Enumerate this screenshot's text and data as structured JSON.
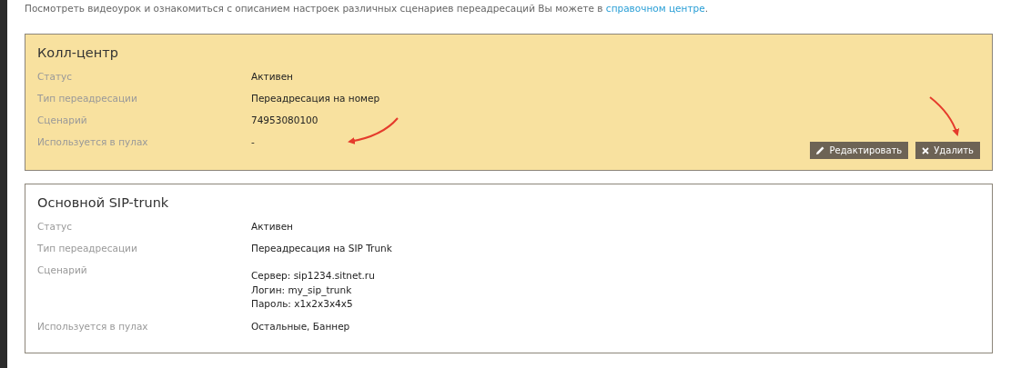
{
  "intro": {
    "text": "Посмотреть видеоурок и ознакомиться с описанием настроек различных сценариев переадресаций Вы можете в ",
    "link": "справочном центре",
    "end": "."
  },
  "cards": [
    {
      "title": "Колл-центр",
      "highlighted": true,
      "rows": [
        {
          "label": "Статус",
          "lines": [
            "Активен"
          ]
        },
        {
          "label": "Тип переадресации",
          "lines": [
            "Переадресация на номер"
          ]
        },
        {
          "label": "Сценарий",
          "lines": [
            "74953080100"
          ]
        },
        {
          "label": "Используется в пулах",
          "lines": [
            "-"
          ]
        }
      ],
      "buttons": [
        {
          "kind": "edit",
          "label": "Редактировать"
        },
        {
          "kind": "delete",
          "label": "Удалить"
        }
      ]
    },
    {
      "title": "Основной SIP-trunk",
      "highlighted": false,
      "rows": [
        {
          "label": "Статус",
          "lines": [
            "Активен"
          ]
        },
        {
          "label": "Тип переадресации",
          "lines": [
            "Переадресация на SIP Trunk"
          ]
        },
        {
          "label": "Сценарий",
          "lines": [
            "Сервер: sip1234.sitnet.ru",
            "Логин: my_sip_trunk",
            "Пароль: x1x2x3x4x5"
          ]
        },
        {
          "label": "Используется в пулах",
          "lines": [
            "Остальные, Баннер"
          ]
        }
      ]
    }
  ]
}
